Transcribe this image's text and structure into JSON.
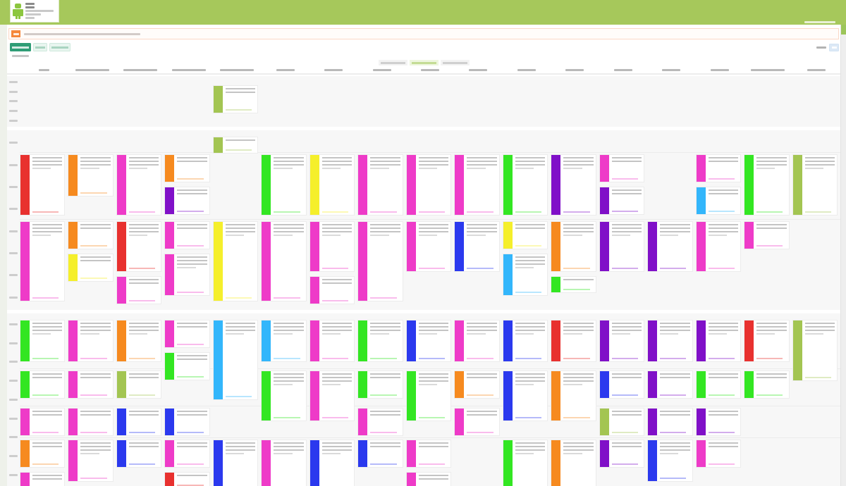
{
  "header": {
    "logo_text": [
      {
        "kind": "short"
      },
      {
        "kind": "short"
      },
      {
        "kind": "long"
      },
      {
        "kind": "medium"
      },
      {
        "kind": "short"
      }
    ],
    "corner_text": {
      "kind": "long"
    }
  },
  "notice": {
    "badge": {
      "kind": "short"
    },
    "message": {
      "kind": "xlong"
    }
  },
  "view_buttons": [
    {
      "label": {
        "kind": "medium"
      },
      "selected": true
    },
    {
      "label": {
        "kind": "short"
      },
      "selected": false
    },
    {
      "label": {
        "kind": "medium"
      },
      "selected": false
    }
  ],
  "caption": {
    "kind": "medium"
  },
  "toolbar": {
    "label": {
      "kind": "short"
    },
    "button": {
      "kind": "short"
    }
  },
  "week_nav": [
    {
      "label": {
        "kind": "long"
      },
      "selected": false
    },
    {
      "label": {
        "kind": "long"
      },
      "selected": true
    },
    {
      "label": {
        "kind": "long"
      },
      "selected": false
    }
  ],
  "columns": [
    {
      "heading": {
        "kind": "short"
      }
    },
    {
      "heading": {
        "kind": "long"
      }
    },
    {
      "heading": {
        "kind": "long"
      }
    },
    {
      "heading": {
        "kind": "long"
      }
    },
    {
      "heading": {
        "kind": "long"
      }
    },
    {
      "heading": {
        "kind": "medium"
      }
    },
    {
      "heading": {
        "kind": "medium"
      }
    },
    {
      "heading": {
        "kind": "medium"
      }
    },
    {
      "heading": {
        "kind": "medium"
      }
    },
    {
      "heading": {
        "kind": "medium"
      }
    },
    {
      "heading": {
        "kind": "medium"
      }
    },
    {
      "heading": {
        "kind": "medium"
      }
    },
    {
      "heading": {
        "kind": "medium"
      }
    },
    {
      "heading": {
        "kind": "medium"
      }
    },
    {
      "heading": {
        "kind": "medium"
      }
    },
    {
      "heading": {
        "kind": "long"
      }
    },
    {
      "heading": {
        "kind": "medium"
      }
    }
  ],
  "sections": [
    {
      "times": [
        {
          "kind": "short"
        },
        {
          "kind": "short"
        },
        {
          "kind": "short"
        },
        {
          "kind": "short"
        },
        {
          "kind": "short"
        }
      ],
      "periods": [
        {
          "cells": [
            {},
            {},
            {},
            {},
            {
              "cards": [
                {
                  "color": "#a3c552",
                  "kind": "short"
                }
              ]
            },
            {},
            {},
            {},
            {},
            {},
            {},
            {},
            {},
            {},
            {},
            {},
            {}
          ]
        }
      ]
    },
    {
      "times": [
        {
          "kind": "short"
        },
        {
          "kind": "short"
        },
        {
          "kind": "short"
        },
        {
          "kind": "short"
        },
        {
          "kind": "short"
        },
        {
          "kind": "short"
        },
        {
          "kind": "short"
        },
        {
          "kind": "short"
        }
      ],
      "periods": [
        {
          "cells": [
            {},
            {},
            {},
            {},
            {
              "cards": [
                {
                  "color": "#a3c552",
                  "kind": "mini"
                }
              ]
            },
            {},
            {},
            {},
            {},
            {},
            {},
            {},
            {},
            {},
            {},
            {},
            {}
          ]
        },
        {
          "cells": [
            {
              "cards": [
                {
                  "color": "#e8312f",
                  "kind": "tall"
                }
              ]
            },
            {
              "cards": [
                {
                  "color": "#f68a1f",
                  "kind": "medium"
                }
              ]
            },
            {
              "cards": [
                {
                  "color": "#ee3bc8",
                  "kind": "tall"
                }
              ]
            },
            {
              "cards": [
                {
                  "color": "#f68a1f",
                  "kind": "short"
                },
                {
                  "color": "#8010c8",
                  "kind": "short"
                }
              ]
            },
            {},
            {
              "cards": [
                {
                  "color": "#33e622",
                  "kind": "tall"
                }
              ]
            },
            {
              "cards": [
                {
                  "color": "#f5ef2b",
                  "kind": "tall"
                }
              ]
            },
            {
              "cards": [
                {
                  "color": "#ee3bc8",
                  "kind": "tall"
                }
              ]
            },
            {
              "cards": [
                {
                  "color": "#ee3bc8",
                  "kind": "tall"
                }
              ]
            },
            {
              "cards": [
                {
                  "color": "#ee3bc8",
                  "kind": "tall"
                }
              ]
            },
            {
              "cards": [
                {
                  "color": "#33e622",
                  "kind": "tall"
                }
              ]
            },
            {
              "cards": [
                {
                  "color": "#8010c8",
                  "kind": "tall"
                }
              ]
            },
            {
              "cards": [
                {
                  "color": "#ee3bc8",
                  "kind": "short"
                },
                {
                  "color": "#8010c8",
                  "kind": "short"
                }
              ]
            },
            {},
            {
              "cards": [
                {
                  "color": "#ee3bc8",
                  "kind": "short"
                },
                {
                  "color": "#33b6fb",
                  "kind": "short"
                }
              ]
            },
            {
              "cards": [
                {
                  "color": "#33e622",
                  "kind": "tall"
                }
              ]
            },
            {
              "cards": [
                {
                  "color": "#a3c552",
                  "kind": "tall"
                }
              ]
            }
          ]
        },
        {
          "cells": [
            {
              "cards": [
                {
                  "color": "#ee3bc8",
                  "kind": "xl"
                }
              ]
            },
            {
              "cards": [
                {
                  "color": "#f68a1f",
                  "kind": "short"
                },
                {
                  "color": "#f5ef2b",
                  "kind": "short"
                }
              ]
            },
            {
              "cards": [
                {
                  "color": "#e8312f",
                  "kind": "long"
                },
                {
                  "color": "#ee3bc8",
                  "kind": "short"
                }
              ]
            },
            {
              "cards": [
                {
                  "color": "#ee3bc8",
                  "kind": "short"
                },
                {
                  "color": "#ee3bc8",
                  "kind": "medium"
                }
              ]
            },
            {
              "cards": [
                {
                  "color": "#f5ef2b",
                  "kind": "xl"
                }
              ]
            },
            {
              "cards": [
                {
                  "color": "#ee3bc8",
                  "kind": "xl"
                }
              ]
            },
            {
              "cards": [
                {
                  "color": "#ee3bc8",
                  "kind": "long"
                },
                {
                  "color": "#ee3bc8",
                  "kind": "short"
                }
              ]
            },
            {
              "cards": [
                {
                  "color": "#ee3bc8",
                  "kind": "xl"
                }
              ]
            },
            {
              "cards": [
                {
                  "color": "#ee3bc8",
                  "kind": "long"
                }
              ]
            },
            {
              "cards": [
                {
                  "color": "#2b39ee",
                  "kind": "long"
                }
              ]
            },
            {
              "cards": [
                {
                  "color": "#f5ef2b",
                  "kind": "short"
                },
                {
                  "color": "#33b6fb",
                  "kind": "medium"
                }
              ]
            },
            {
              "cards": [
                {
                  "color": "#f68a1f",
                  "kind": "long"
                },
                {
                  "color": "#33e622",
                  "kind": "mini"
                }
              ]
            },
            {
              "cards": [
                {
                  "color": "#8010c8",
                  "kind": "long"
                }
              ]
            },
            {
              "cards": [
                {
                  "color": "#8010c8",
                  "kind": "long"
                }
              ]
            },
            {
              "cards": [
                {
                  "color": "#ee3bc8",
                  "kind": "long"
                }
              ]
            },
            {
              "cards": [
                {
                  "color": "#ee3bc8",
                  "kind": "short"
                }
              ]
            },
            {}
          ]
        }
      ]
    },
    {
      "times": [
        {
          "kind": "short"
        },
        {
          "kind": "short"
        },
        {
          "kind": "short"
        },
        {
          "kind": "short"
        },
        {
          "kind": "short"
        },
        {
          "kind": "short"
        },
        {
          "kind": "short"
        },
        {
          "kind": "short"
        },
        {
          "kind": "short"
        }
      ],
      "periods": [
        {
          "cells": [
            {
              "cards": [
                {
                  "color": "#33e622",
                  "kind": "medium"
                }
              ]
            },
            {
              "cards": [
                {
                  "color": "#ee3bc8",
                  "kind": "medium"
                }
              ]
            },
            {
              "cards": [
                {
                  "color": "#f68a1f",
                  "kind": "medium"
                }
              ]
            },
            {
              "cards": [
                {
                  "color": "#ee3bc8",
                  "kind": "short"
                },
                {
                  "color": "#33e622",
                  "kind": "short"
                }
              ]
            },
            {
              "cards": [
                {
                  "color": "#33b6fb",
                  "kind": "xl"
                }
              ]
            },
            {
              "cards": [
                {
                  "color": "#33b6fb",
                  "kind": "medium"
                }
              ]
            },
            {
              "cards": [
                {
                  "color": "#ee3bc8",
                  "kind": "medium"
                }
              ]
            },
            {
              "cards": [
                {
                  "color": "#33e622",
                  "kind": "medium"
                }
              ]
            },
            {
              "cards": [
                {
                  "color": "#2b39ee",
                  "kind": "medium"
                }
              ]
            },
            {
              "cards": [
                {
                  "color": "#ee3bc8",
                  "kind": "medium"
                }
              ]
            },
            {
              "cards": [
                {
                  "color": "#2b39ee",
                  "kind": "medium"
                }
              ]
            },
            {
              "cards": [
                {
                  "color": "#e8312f",
                  "kind": "medium"
                }
              ]
            },
            {
              "cards": [
                {
                  "color": "#8010c8",
                  "kind": "medium"
                }
              ]
            },
            {
              "cards": [
                {
                  "color": "#8010c8",
                  "kind": "medium"
                }
              ]
            },
            {
              "cards": [
                {
                  "color": "#8010c8",
                  "kind": "medium"
                }
              ]
            },
            {
              "cards": [
                {
                  "color": "#e8312f",
                  "kind": "medium"
                }
              ]
            },
            {
              "cards": [
                {
                  "color": "#a3c552",
                  "kind": "tall"
                }
              ]
            }
          ]
        },
        {
          "cells": [
            {
              "cards": [
                {
                  "color": "#33e622",
                  "kind": "short"
                }
              ]
            },
            {
              "cards": [
                {
                  "color": "#ee3bc8",
                  "kind": "short"
                }
              ]
            },
            {
              "cards": [
                {
                  "color": "#a3c552",
                  "kind": "short"
                }
              ]
            },
            {},
            {},
            {
              "cards": [
                {
                  "color": "#33e622",
                  "kind": "long"
                }
              ]
            },
            {
              "cards": [
                {
                  "color": "#ee3bc8",
                  "kind": "long"
                }
              ]
            },
            {
              "cards": [
                {
                  "color": "#33e622",
                  "kind": "short"
                }
              ]
            },
            {
              "cards": [
                {
                  "color": "#33e622",
                  "kind": "long"
                }
              ]
            },
            {
              "cards": [
                {
                  "color": "#f68a1f",
                  "kind": "short"
                }
              ]
            },
            {
              "cards": [
                {
                  "color": "#2b39ee",
                  "kind": "long"
                }
              ]
            },
            {
              "cards": [
                {
                  "color": "#f68a1f",
                  "kind": "long"
                }
              ]
            },
            {
              "cards": [
                {
                  "color": "#2b39ee",
                  "kind": "short"
                }
              ]
            },
            {
              "cards": [
                {
                  "color": "#8010c8",
                  "kind": "short"
                }
              ]
            },
            {
              "cards": [
                {
                  "color": "#33e622",
                  "kind": "short"
                }
              ]
            },
            {
              "cards": [
                {
                  "color": "#33e622",
                  "kind": "short"
                }
              ]
            },
            {}
          ]
        },
        {
          "cells": [
            {
              "cards": [
                {
                  "color": "#ee3bc8",
                  "kind": "short"
                }
              ]
            },
            {
              "cards": [
                {
                  "color": "#ee3bc8",
                  "kind": "short"
                }
              ]
            },
            {
              "cards": [
                {
                  "color": "#2b39ee",
                  "kind": "short"
                }
              ]
            },
            {
              "cards": [
                {
                  "color": "#2b39ee",
                  "kind": "short"
                }
              ]
            },
            {},
            {},
            {},
            {
              "cards": [
                {
                  "color": "#ee3bc8",
                  "kind": "short"
                }
              ]
            },
            {},
            {
              "cards": [
                {
                  "color": "#ee3bc8",
                  "kind": "short"
                }
              ]
            },
            {},
            {},
            {
              "cards": [
                {
                  "color": "#a3c552",
                  "kind": "short"
                }
              ]
            },
            {
              "cards": [
                {
                  "color": "#8010c8",
                  "kind": "short"
                }
              ]
            },
            {
              "cards": [
                {
                  "color": "#8010c8",
                  "kind": "short"
                }
              ]
            },
            {},
            {}
          ]
        },
        {
          "cells": [
            {
              "cards": [
                {
                  "color": "#f68a1f",
                  "kind": "short"
                },
                {
                  "color": "#ee3bc8",
                  "kind": "short"
                }
              ]
            },
            {
              "cards": [
                {
                  "color": "#ee3bc8",
                  "kind": "medium"
                }
              ]
            },
            {
              "cards": [
                {
                  "color": "#2b39ee",
                  "kind": "short"
                }
              ]
            },
            {
              "cards": [
                {
                  "color": "#ee3bc8",
                  "kind": "short"
                },
                {
                  "color": "#e8312f",
                  "kind": "mini"
                }
              ]
            },
            {
              "cards": [
                {
                  "color": "#2b39ee",
                  "kind": "xl"
                }
              ]
            },
            {
              "cards": [
                {
                  "color": "#ee3bc8",
                  "kind": "xl"
                }
              ]
            },
            {
              "cards": [
                {
                  "color": "#2b39ee",
                  "kind": "xl"
                }
              ]
            },
            {
              "cards": [
                {
                  "color": "#2b39ee",
                  "kind": "short"
                }
              ]
            },
            {
              "cards": [
                {
                  "color": "#ee3bc8",
                  "kind": "short"
                },
                {
                  "color": "#ee3bc8",
                  "kind": "short"
                }
              ]
            },
            {},
            {
              "cards": [
                {
                  "color": "#33e622",
                  "kind": "xl"
                }
              ]
            },
            {
              "cards": [
                {
                  "color": "#f68a1f",
                  "kind": "xl"
                }
              ]
            },
            {
              "cards": [
                {
                  "color": "#8010c8",
                  "kind": "short"
                }
              ]
            },
            {
              "cards": [
                {
                  "color": "#2b39ee",
                  "kind": "medium"
                }
              ]
            },
            {
              "cards": [
                {
                  "color": "#ee3bc8",
                  "kind": "short"
                }
              ]
            },
            {},
            {}
          ]
        }
      ]
    }
  ]
}
